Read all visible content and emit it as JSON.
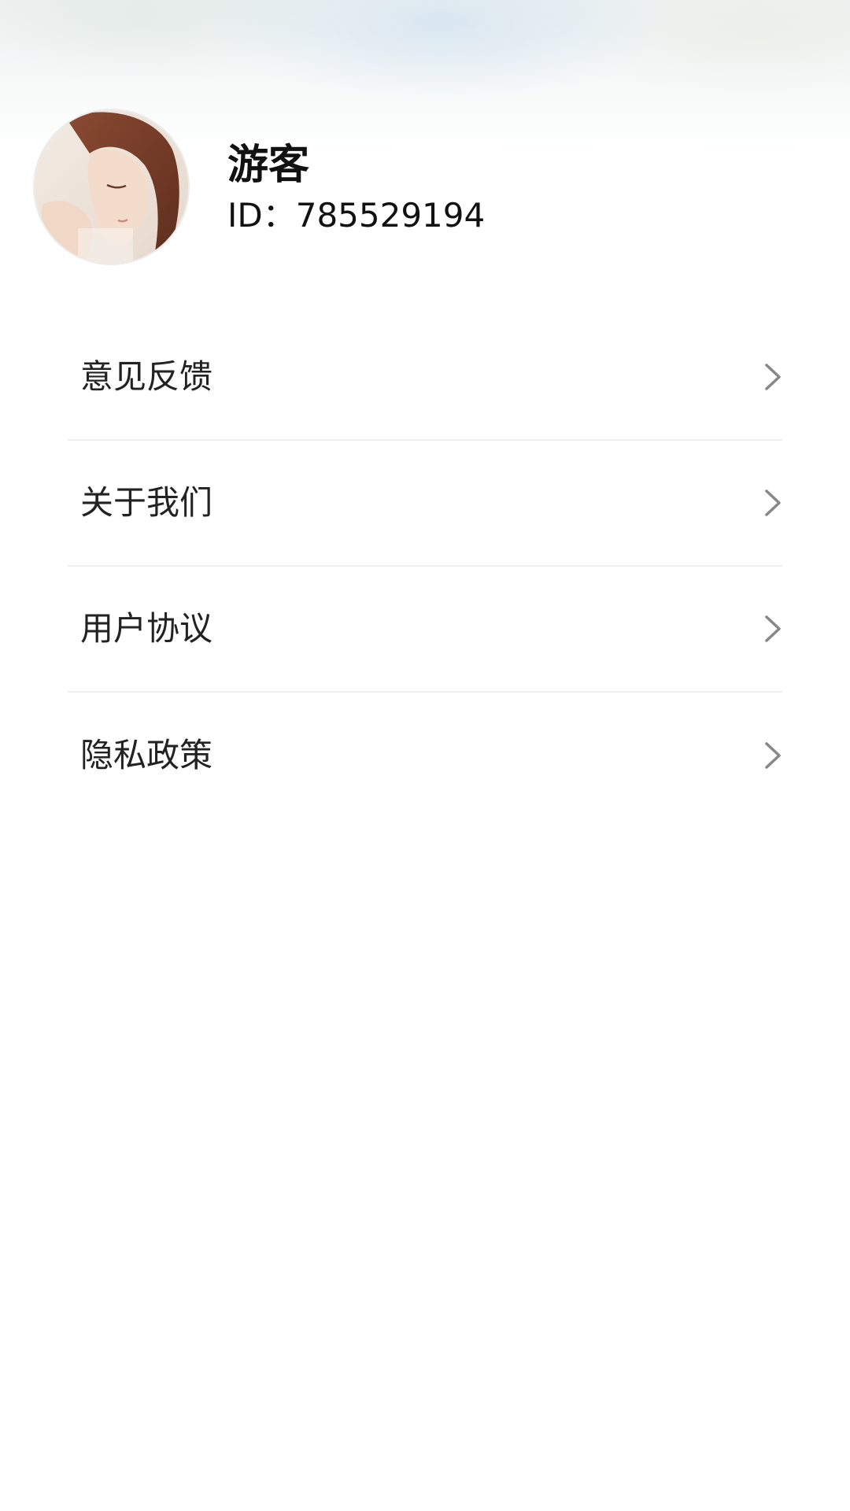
{
  "profile": {
    "name": "游客",
    "id_text": "ID：785529194"
  },
  "menu": {
    "items": [
      {
        "label": "意见反馈",
        "icon": "chevron-right-icon"
      },
      {
        "label": "关于我们",
        "icon": "chevron-right-icon"
      },
      {
        "label": "用户协议",
        "icon": "chevron-right-icon"
      },
      {
        "label": "隐私政策",
        "icon": "chevron-right-icon"
      }
    ]
  },
  "colors": {
    "text_primary": "#111111",
    "menu_text": "#222222",
    "divider": "#eeeeee",
    "chevron": "#888888"
  }
}
